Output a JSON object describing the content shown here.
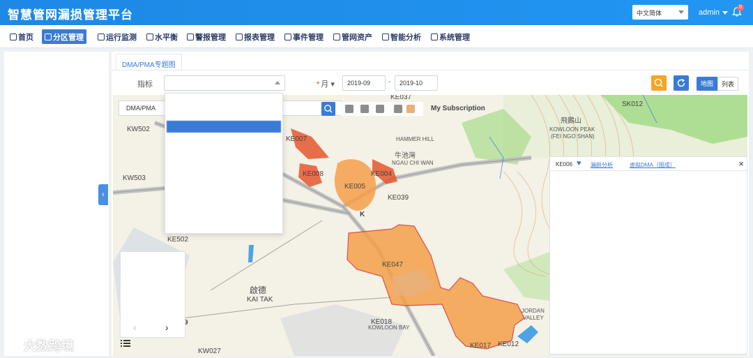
{
  "app": {
    "title": "智慧管网漏损管理平台"
  },
  "header": {
    "language": "中文简体",
    "user": "admin",
    "notification_count": "0"
  },
  "nav": {
    "items": [
      {
        "label": "首页",
        "icon": "home-icon"
      },
      {
        "label": "分区管理",
        "icon": "partition-icon",
        "active": true
      },
      {
        "label": "运行监测",
        "icon": "monitor-icon"
      },
      {
        "label": "水平衡",
        "icon": "balance-icon"
      },
      {
        "label": "警报管理",
        "icon": "alarm-icon"
      },
      {
        "label": "报表管理",
        "icon": "report-icon"
      },
      {
        "label": "事件管理",
        "icon": "event-icon"
      },
      {
        "label": "管网资产",
        "icon": "asset-icon"
      },
      {
        "label": "智能分析",
        "icon": "analysis-icon"
      },
      {
        "label": "系统管理",
        "icon": "settings-icon"
      }
    ]
  },
  "tab": {
    "label": "DMA/PMA专题图"
  },
  "filters": {
    "indicator_label": "指标",
    "month_label": "月",
    "date_from": "2019-09",
    "date_sep": "-",
    "date_to": "2019-10",
    "view_map": "地图",
    "view_list": "列表"
  },
  "map_toolbar": {
    "layer_label": "DMA/PMA",
    "subscription": "My Subscription"
  },
  "dropdown": {
    "selected_option": ""
  },
  "map_labels": {
    "KE037": "KE037",
    "KE007": "KE007",
    "KE008": "KE008",
    "KE005": "KE005",
    "KE004": "KE004",
    "KE039": "KE039",
    "KE502": "KE502",
    "KW502": "KW502",
    "KW503": "KW503",
    "KE018": "KE018",
    "KE017": "KE017",
    "KE012": "KE012",
    "KW027": "KW027",
    "KE047": "KE047",
    "SK012": "SK012",
    "kai_tak": "KAI TAK",
    "kai_tak_cn": "啟德",
    "kowloon_bay": "KOWLOON BAY",
    "kowloon_peak": "KOWLOON PEAK",
    "fei_ngo_shan": "(FEI NGO SHAN)",
    "fei_ngo_shan_cn": "飛鵝山",
    "jordan_valley": "JORDAN",
    "valley": "VALLEY",
    "ngau_chi_wan": "NGAU CHI WAN",
    "ngau_chi_wan_cn": "牛池灣",
    "hammer_hill": "HAMMER HILL",
    "k": "K",
    "nine": "9"
  },
  "info_panel": {
    "id": "KE006",
    "link_analysis": "漏损分析",
    "link_dma": "虚拟DMA（图成）"
  },
  "watermark": {
    "text": "大数跨境"
  },
  "colors": {
    "header": "#2196f3",
    "accent": "#3a7bd5",
    "dma_orange": "#f5a04a",
    "dma_red": "#e4572e"
  }
}
